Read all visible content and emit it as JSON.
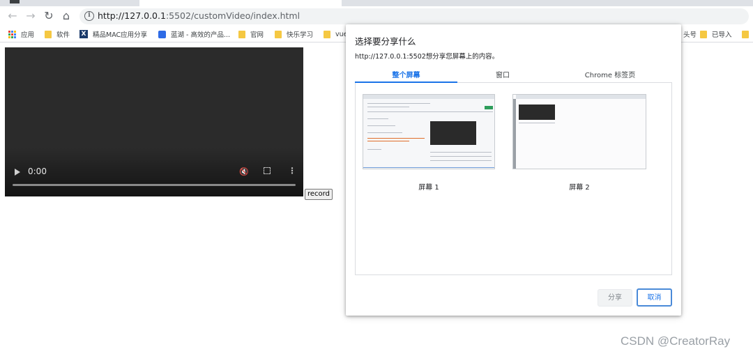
{
  "browser": {
    "url_host": "http://127.0.0.1",
    "url_rest": ":5502/customVideo/index.html"
  },
  "bookmarks": [
    "应用",
    "软件",
    "精品MAC应用分享",
    "蓝湖 - 高效的产品...",
    "官网",
    "快乐学习",
    "vue",
    "头号",
    "已导入"
  ],
  "video": {
    "time": "0:00"
  },
  "record_label": "record",
  "dialog": {
    "title": "选择要分享什么",
    "message": "http://127.0.0.1:5502想分享您屏幕上的内容。",
    "tabs": [
      "整个屏幕",
      "窗口",
      "Chrome 标签页"
    ],
    "active_tab": 0,
    "screens": [
      "屏幕 1",
      "屏幕 2"
    ],
    "share_label": "分享",
    "cancel_label": "取消"
  },
  "watermark": "CSDN @CreatorRay",
  "colors": {
    "accent": "#1a73e8",
    "folder": "#f5c842"
  }
}
